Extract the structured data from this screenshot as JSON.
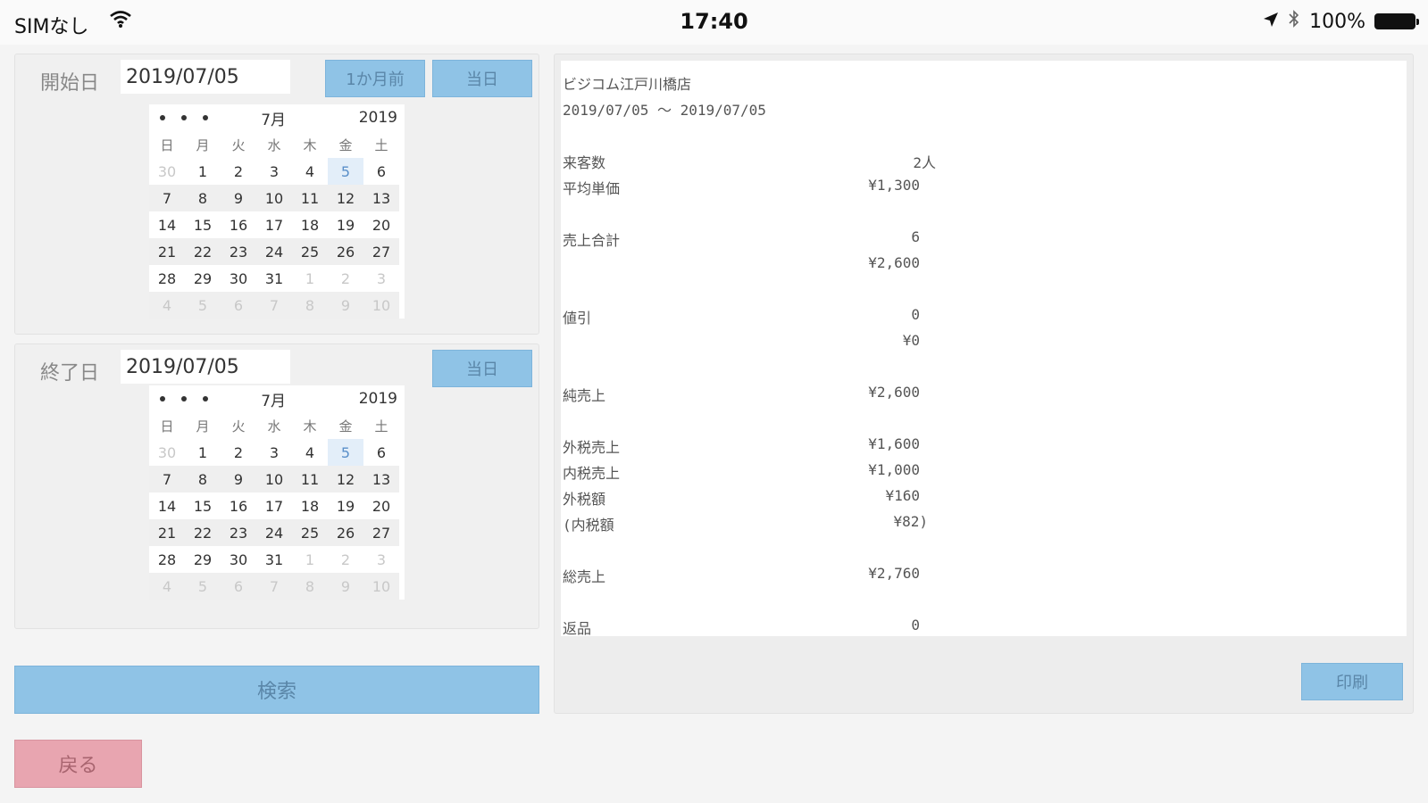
{
  "status_bar": {
    "carrier": "SIMなし",
    "time": "17:40",
    "battery": "100%"
  },
  "start": {
    "label": "開始日",
    "date": "2019/07/05",
    "btn_month": "1か月前",
    "btn_today": "当日",
    "calendar": {
      "month": "7月",
      "year": "2019",
      "weekdays": [
        "日",
        "月",
        "火",
        "水",
        "木",
        "金",
        "土"
      ],
      "selected_day": 5,
      "weeks": [
        [
          "30",
          "1",
          "2",
          "3",
          "4",
          "5",
          "6"
        ],
        [
          "7",
          "8",
          "9",
          "10",
          "11",
          "12",
          "13"
        ],
        [
          "14",
          "15",
          "16",
          "17",
          "18",
          "19",
          "20"
        ],
        [
          "21",
          "22",
          "23",
          "24",
          "25",
          "26",
          "27"
        ],
        [
          "28",
          "29",
          "30",
          "31",
          "1",
          "2",
          "3"
        ],
        [
          "4",
          "5",
          "6",
          "7",
          "8",
          "9",
          "10"
        ]
      ]
    }
  },
  "end": {
    "label": "終了日",
    "date": "2019/07/05",
    "btn_today": "当日",
    "calendar": {
      "month": "7月",
      "year": "2019",
      "weekdays": [
        "日",
        "月",
        "火",
        "水",
        "木",
        "金",
        "土"
      ],
      "selected_day": 5,
      "weeks": [
        [
          "30",
          "1",
          "2",
          "3",
          "4",
          "5",
          "6"
        ],
        [
          "7",
          "8",
          "9",
          "10",
          "11",
          "12",
          "13"
        ],
        [
          "14",
          "15",
          "16",
          "17",
          "18",
          "19",
          "20"
        ],
        [
          "21",
          "22",
          "23",
          "24",
          "25",
          "26",
          "27"
        ],
        [
          "28",
          "29",
          "30",
          "31",
          "1",
          "2",
          "3"
        ],
        [
          "4",
          "5",
          "6",
          "7",
          "8",
          "9",
          "10"
        ]
      ]
    }
  },
  "search_label": "検索",
  "back_label": "戻る",
  "report": {
    "store": "ビジコム江戸川橋店",
    "range": "2019/07/05 ～ 2019/07/05",
    "rows": [
      {
        "label": "来客数",
        "value": "2人",
        "vcol": "a"
      },
      {
        "label": "平均単価",
        "value": "¥1,300",
        "vcol": "b"
      },
      {
        "label": "売上合計",
        "value": "6",
        "vcol": "b",
        "gap": true
      },
      {
        "label": "",
        "value": "¥2,600",
        "vcol": "b"
      },
      {
        "label": "値引",
        "value": "0",
        "vcol": "b",
        "gap": true
      },
      {
        "label": "",
        "value": "¥0",
        "vcol": "b"
      },
      {
        "label": "純売上",
        "value": "¥2,600",
        "vcol": "b",
        "gap": true
      },
      {
        "label": "外税売上",
        "value": "¥1,600",
        "vcol": "b",
        "gap": true
      },
      {
        "label": "内税売上",
        "value": "¥1,000",
        "vcol": "b"
      },
      {
        "label": "外税額",
        "value": "¥160",
        "vcol": "b"
      },
      {
        "label": "(内税額",
        "value": "¥82)",
        "vcol": "c"
      },
      {
        "label": "総売上",
        "value": "¥2,760",
        "vcol": "b",
        "gap": true
      },
      {
        "label": "返品",
        "value": "0",
        "vcol": "b",
        "gap": true
      }
    ],
    "print_label": "印刷"
  }
}
